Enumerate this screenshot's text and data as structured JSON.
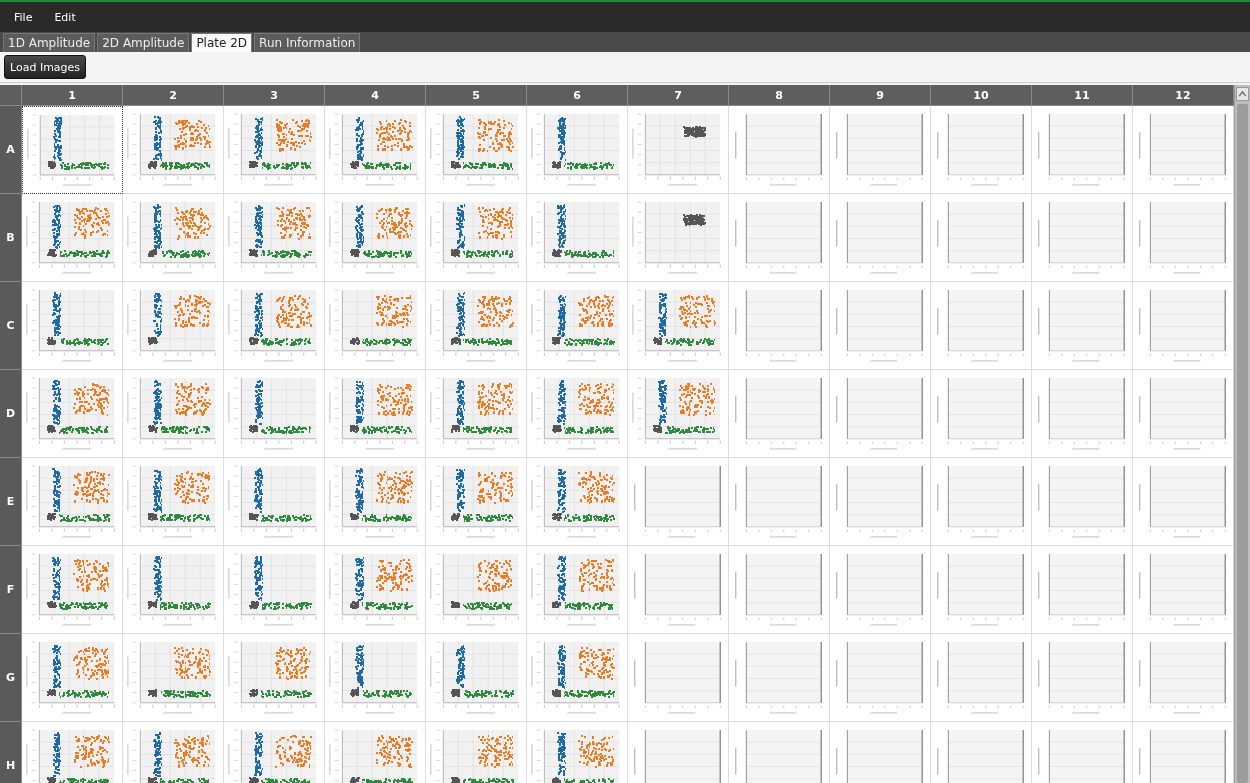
{
  "menu": [
    "File",
    "Edit"
  ],
  "tabs": [
    {
      "label": "1D Amplitude",
      "selected": false
    },
    {
      "label": "2D Amplitude",
      "selected": false
    },
    {
      "label": "Plate 2D",
      "selected": true
    },
    {
      "label": "Run Information",
      "selected": false
    }
  ],
  "toolbar": {
    "button": "Load Images"
  },
  "plate": {
    "columns": [
      "1",
      "2",
      "3",
      "4",
      "5",
      "6",
      "7",
      "8",
      "9",
      "10",
      "11",
      "12"
    ],
    "rows": [
      {
        "label": "A",
        "wells": [
          {
            "kind": "scatter",
            "selected": true,
            "clusters": [
              {
                "kind": "negative",
                "color": "#555555"
              },
              {
                "kind": "ch1",
                "color": "#1f6aa5"
              },
              {
                "kind": "ch2",
                "color": "#2e8b3e"
              }
            ]
          },
          {
            "kind": "scatter",
            "selected": false,
            "clusters": [
              {
                "kind": "negative",
                "color": "#555555"
              },
              {
                "kind": "ch1",
                "color": "#1f6aa5"
              },
              {
                "kind": "ch2",
                "color": "#2e8b3e"
              },
              {
                "kind": "double",
                "color": "#f07a1f"
              }
            ]
          },
          {
            "kind": "scatter",
            "selected": false,
            "clusters": [
              {
                "kind": "negative",
                "color": "#555555"
              },
              {
                "kind": "ch1",
                "color": "#1f6aa5"
              },
              {
                "kind": "ch2",
                "color": "#2e8b3e"
              },
              {
                "kind": "double",
                "color": "#f07a1f"
              }
            ]
          },
          {
            "kind": "scatter",
            "selected": false,
            "clusters": [
              {
                "kind": "negative",
                "color": "#555555"
              },
              {
                "kind": "ch1",
                "color": "#1f6aa5"
              },
              {
                "kind": "ch2",
                "color": "#2e8b3e"
              },
              {
                "kind": "double",
                "color": "#f07a1f"
              }
            ]
          },
          {
            "kind": "scatter",
            "selected": false,
            "clusters": [
              {
                "kind": "negative",
                "color": "#555555"
              },
              {
                "kind": "ch1",
                "color": "#1f6aa5"
              },
              {
                "kind": "ch2",
                "color": "#2e8b3e"
              },
              {
                "kind": "double",
                "color": "#f07a1f"
              }
            ]
          },
          {
            "kind": "scatter",
            "selected": false,
            "clusters": [
              {
                "kind": "negative",
                "color": "#555555"
              },
              {
                "kind": "ch1",
                "color": "#1f6aa5"
              },
              {
                "kind": "ch2",
                "color": "#2e8b3e"
              }
            ]
          },
          {
            "kind": "scatter",
            "selected": false,
            "clusters": [
              {
                "kind": "blob",
                "color": "#555555"
              }
            ]
          },
          {
            "kind": "blank",
            "selected": false
          },
          {
            "kind": "blank",
            "selected": false
          },
          {
            "kind": "blank",
            "selected": false
          },
          {
            "kind": "blank",
            "selected": false
          },
          {
            "kind": "blank",
            "selected": false
          }
        ]
      },
      {
        "label": "B",
        "wells": [
          {
            "kind": "scatter",
            "selected": false,
            "clusters": [
              {
                "kind": "negative",
                "color": "#555555"
              },
              {
                "kind": "ch1",
                "color": "#1f6aa5"
              },
              {
                "kind": "ch2",
                "color": "#2e8b3e"
              },
              {
                "kind": "double",
                "color": "#f07a1f"
              }
            ]
          },
          {
            "kind": "scatter",
            "selected": false,
            "clusters": [
              {
                "kind": "negative",
                "color": "#555555"
              },
              {
                "kind": "ch1",
                "color": "#1f6aa5"
              },
              {
                "kind": "ch2",
                "color": "#2e8b3e"
              },
              {
                "kind": "double",
                "color": "#f07a1f"
              }
            ]
          },
          {
            "kind": "scatter",
            "selected": false,
            "clusters": [
              {
                "kind": "negative",
                "color": "#555555"
              },
              {
                "kind": "ch1",
                "color": "#1f6aa5"
              },
              {
                "kind": "ch2",
                "color": "#2e8b3e"
              },
              {
                "kind": "double",
                "color": "#f07a1f"
              }
            ]
          },
          {
            "kind": "scatter",
            "selected": false,
            "clusters": [
              {
                "kind": "negative",
                "color": "#555555"
              },
              {
                "kind": "ch1",
                "color": "#1f6aa5"
              },
              {
                "kind": "ch2",
                "color": "#2e8b3e"
              },
              {
                "kind": "double",
                "color": "#f07a1f"
              }
            ]
          },
          {
            "kind": "scatter",
            "selected": false,
            "clusters": [
              {
                "kind": "negative",
                "color": "#555555"
              },
              {
                "kind": "ch1",
                "color": "#1f6aa5"
              },
              {
                "kind": "ch2",
                "color": "#2e8b3e"
              },
              {
                "kind": "double",
                "color": "#f07a1f"
              }
            ]
          },
          {
            "kind": "scatter",
            "selected": false,
            "clusters": [
              {
                "kind": "negative",
                "color": "#555555"
              },
              {
                "kind": "ch1",
                "color": "#1f6aa5"
              },
              {
                "kind": "ch2",
                "color": "#2e8b3e"
              }
            ]
          },
          {
            "kind": "scatter",
            "selected": false,
            "clusters": [
              {
                "kind": "blob",
                "color": "#555555"
              }
            ]
          },
          {
            "kind": "blank",
            "selected": false
          },
          {
            "kind": "blank",
            "selected": false
          },
          {
            "kind": "blank",
            "selected": false
          },
          {
            "kind": "blank",
            "selected": false
          },
          {
            "kind": "blank",
            "selected": false
          }
        ]
      },
      {
        "label": "C",
        "wells": [
          {
            "kind": "scatter",
            "selected": false,
            "clusters": [
              {
                "kind": "negative",
                "color": "#555555"
              },
              {
                "kind": "ch1",
                "color": "#1f6aa5"
              },
              {
                "kind": "ch2",
                "color": "#2e8b3e"
              }
            ]
          },
          {
            "kind": "scatter",
            "selected": false,
            "clusters": [
              {
                "kind": "negative",
                "color": "#555555"
              },
              {
                "kind": "ch1",
                "color": "#1f6aa5"
              },
              {
                "kind": "double",
                "color": "#f07a1f"
              }
            ]
          },
          {
            "kind": "scatter",
            "selected": false,
            "clusters": [
              {
                "kind": "negative",
                "color": "#555555"
              },
              {
                "kind": "ch1",
                "color": "#1f6aa5"
              },
              {
                "kind": "ch2",
                "color": "#2e8b3e"
              },
              {
                "kind": "double",
                "color": "#f07a1f"
              }
            ]
          },
          {
            "kind": "scatter",
            "selected": false,
            "clusters": [
              {
                "kind": "negative",
                "color": "#555555"
              },
              {
                "kind": "ch2",
                "color": "#2e8b3e"
              },
              {
                "kind": "double",
                "color": "#f07a1f"
              }
            ]
          },
          {
            "kind": "scatter",
            "selected": false,
            "clusters": [
              {
                "kind": "negative",
                "color": "#555555"
              },
              {
                "kind": "ch1",
                "color": "#1f6aa5"
              },
              {
                "kind": "ch2",
                "color": "#2e8b3e"
              },
              {
                "kind": "double",
                "color": "#f07a1f"
              }
            ]
          },
          {
            "kind": "scatter",
            "selected": false,
            "clusters": [
              {
                "kind": "negative",
                "color": "#555555"
              },
              {
                "kind": "ch1",
                "color": "#1f6aa5"
              },
              {
                "kind": "ch2",
                "color": "#2e8b3e"
              },
              {
                "kind": "double",
                "color": "#f07a1f"
              }
            ]
          },
          {
            "kind": "scatter",
            "selected": false,
            "clusters": [
              {
                "kind": "negative",
                "color": "#555555"
              },
              {
                "kind": "ch1",
                "color": "#1f6aa5"
              },
              {
                "kind": "ch2",
                "color": "#2e8b3e"
              },
              {
                "kind": "double",
                "color": "#f07a1f"
              }
            ]
          },
          {
            "kind": "blank",
            "selected": false
          },
          {
            "kind": "blank",
            "selected": false
          },
          {
            "kind": "blank",
            "selected": false
          },
          {
            "kind": "blank",
            "selected": false
          },
          {
            "kind": "blank",
            "selected": false
          }
        ]
      },
      {
        "label": "D",
        "wells": [
          {
            "kind": "scatter",
            "selected": false,
            "clusters": [
              {
                "kind": "negative",
                "color": "#555555"
              },
              {
                "kind": "ch1",
                "color": "#1f6aa5"
              },
              {
                "kind": "ch2",
                "color": "#2e8b3e"
              },
              {
                "kind": "double",
                "color": "#f07a1f"
              }
            ]
          },
          {
            "kind": "scatter",
            "selected": false,
            "clusters": [
              {
                "kind": "negative",
                "color": "#555555"
              },
              {
                "kind": "ch1",
                "color": "#1f6aa5"
              },
              {
                "kind": "ch2",
                "color": "#2e8b3e"
              },
              {
                "kind": "double",
                "color": "#f07a1f"
              }
            ]
          },
          {
            "kind": "scatter",
            "selected": false,
            "clusters": [
              {
                "kind": "negative",
                "color": "#555555"
              },
              {
                "kind": "ch1",
                "color": "#1f6aa5"
              },
              {
                "kind": "ch2",
                "color": "#2e8b3e"
              }
            ]
          },
          {
            "kind": "scatter",
            "selected": false,
            "clusters": [
              {
                "kind": "negative",
                "color": "#555555"
              },
              {
                "kind": "ch1",
                "color": "#1f6aa5"
              },
              {
                "kind": "ch2",
                "color": "#2e8b3e"
              },
              {
                "kind": "double",
                "color": "#f07a1f"
              }
            ]
          },
          {
            "kind": "scatter",
            "selected": false,
            "clusters": [
              {
                "kind": "negative",
                "color": "#555555"
              },
              {
                "kind": "ch1",
                "color": "#1f6aa5"
              },
              {
                "kind": "ch2",
                "color": "#2e8b3e"
              },
              {
                "kind": "double",
                "color": "#f07a1f"
              }
            ]
          },
          {
            "kind": "scatter",
            "selected": false,
            "clusters": [
              {
                "kind": "negative",
                "color": "#555555"
              },
              {
                "kind": "ch1",
                "color": "#1f6aa5"
              },
              {
                "kind": "ch2",
                "color": "#2e8b3e"
              },
              {
                "kind": "double",
                "color": "#f07a1f"
              }
            ]
          },
          {
            "kind": "scatter",
            "selected": false,
            "clusters": [
              {
                "kind": "negative",
                "color": "#555555"
              },
              {
                "kind": "ch1",
                "color": "#1f6aa5"
              },
              {
                "kind": "ch2",
                "color": "#2e8b3e"
              },
              {
                "kind": "double",
                "color": "#f07a1f"
              }
            ]
          },
          {
            "kind": "blank",
            "selected": false
          },
          {
            "kind": "blank",
            "selected": false
          },
          {
            "kind": "blank",
            "selected": false
          },
          {
            "kind": "blank",
            "selected": false
          },
          {
            "kind": "blank",
            "selected": false
          }
        ]
      },
      {
        "label": "E",
        "wells": [
          {
            "kind": "scatter",
            "selected": false,
            "clusters": [
              {
                "kind": "negative",
                "color": "#555555"
              },
              {
                "kind": "ch1",
                "color": "#1f6aa5"
              },
              {
                "kind": "ch2",
                "color": "#2e8b3e"
              },
              {
                "kind": "double",
                "color": "#f07a1f"
              }
            ]
          },
          {
            "kind": "scatter",
            "selected": false,
            "clusters": [
              {
                "kind": "negative",
                "color": "#555555"
              },
              {
                "kind": "ch1",
                "color": "#1f6aa5"
              },
              {
                "kind": "ch2",
                "color": "#2e8b3e"
              },
              {
                "kind": "double",
                "color": "#f07a1f"
              }
            ]
          },
          {
            "kind": "scatter",
            "selected": false,
            "clusters": [
              {
                "kind": "negative",
                "color": "#555555"
              },
              {
                "kind": "ch1",
                "color": "#1f6aa5"
              },
              {
                "kind": "ch2",
                "color": "#2e8b3e"
              }
            ]
          },
          {
            "kind": "scatter",
            "selected": false,
            "clusters": [
              {
                "kind": "negative",
                "color": "#555555"
              },
              {
                "kind": "ch1",
                "color": "#1f6aa5"
              },
              {
                "kind": "ch2",
                "color": "#2e8b3e"
              },
              {
                "kind": "double",
                "color": "#f07a1f"
              }
            ]
          },
          {
            "kind": "scatter",
            "selected": false,
            "clusters": [
              {
                "kind": "negative",
                "color": "#555555"
              },
              {
                "kind": "ch1",
                "color": "#1f6aa5"
              },
              {
                "kind": "ch2",
                "color": "#2e8b3e"
              },
              {
                "kind": "double",
                "color": "#f07a1f"
              }
            ]
          },
          {
            "kind": "scatter",
            "selected": false,
            "clusters": [
              {
                "kind": "negative",
                "color": "#555555"
              },
              {
                "kind": "ch1",
                "color": "#1f6aa5"
              },
              {
                "kind": "ch2",
                "color": "#2e8b3e"
              },
              {
                "kind": "double",
                "color": "#f07a1f"
              }
            ]
          },
          {
            "kind": "blank",
            "selected": false
          },
          {
            "kind": "blank",
            "selected": false
          },
          {
            "kind": "blank",
            "selected": false
          },
          {
            "kind": "blank",
            "selected": false
          },
          {
            "kind": "blank",
            "selected": false
          },
          {
            "kind": "blank",
            "selected": false
          }
        ]
      },
      {
        "label": "F",
        "wells": [
          {
            "kind": "scatter",
            "selected": false,
            "clusters": [
              {
                "kind": "negative",
                "color": "#555555"
              },
              {
                "kind": "ch1",
                "color": "#1f6aa5"
              },
              {
                "kind": "ch2",
                "color": "#2e8b3e"
              },
              {
                "kind": "double",
                "color": "#f07a1f"
              }
            ]
          },
          {
            "kind": "scatter",
            "selected": false,
            "clusters": [
              {
                "kind": "negative",
                "color": "#555555"
              },
              {
                "kind": "ch1",
                "color": "#1f6aa5"
              },
              {
                "kind": "ch2",
                "color": "#2e8b3e"
              }
            ]
          },
          {
            "kind": "scatter",
            "selected": false,
            "clusters": [
              {
                "kind": "negative",
                "color": "#555555"
              },
              {
                "kind": "ch1",
                "color": "#1f6aa5"
              },
              {
                "kind": "ch2",
                "color": "#2e8b3e"
              }
            ]
          },
          {
            "kind": "scatter",
            "selected": false,
            "clusters": [
              {
                "kind": "negative",
                "color": "#555555"
              },
              {
                "kind": "ch1",
                "color": "#1f6aa5"
              },
              {
                "kind": "ch2",
                "color": "#2e8b3e"
              },
              {
                "kind": "double",
                "color": "#f07a1f"
              }
            ]
          },
          {
            "kind": "scatter",
            "selected": false,
            "clusters": [
              {
                "kind": "negative",
                "color": "#555555"
              },
              {
                "kind": "ch2",
                "color": "#2e8b3e"
              },
              {
                "kind": "double",
                "color": "#f07a1f"
              }
            ]
          },
          {
            "kind": "scatter",
            "selected": false,
            "clusters": [
              {
                "kind": "negative",
                "color": "#555555"
              },
              {
                "kind": "ch1",
                "color": "#1f6aa5"
              },
              {
                "kind": "ch2",
                "color": "#2e8b3e"
              },
              {
                "kind": "double",
                "color": "#f07a1f"
              }
            ]
          },
          {
            "kind": "blank",
            "selected": false
          },
          {
            "kind": "blank",
            "selected": false
          },
          {
            "kind": "blank",
            "selected": false
          },
          {
            "kind": "blank",
            "selected": false
          },
          {
            "kind": "blank",
            "selected": false
          },
          {
            "kind": "blank",
            "selected": false
          }
        ]
      },
      {
        "label": "G",
        "wells": [
          {
            "kind": "scatter",
            "selected": false,
            "clusters": [
              {
                "kind": "negative",
                "color": "#555555"
              },
              {
                "kind": "ch1",
                "color": "#1f6aa5"
              },
              {
                "kind": "ch2",
                "color": "#2e8b3e"
              },
              {
                "kind": "double",
                "color": "#f07a1f"
              }
            ]
          },
          {
            "kind": "scatter",
            "selected": false,
            "clusters": [
              {
                "kind": "negative",
                "color": "#555555"
              },
              {
                "kind": "ch2",
                "color": "#2e8b3e"
              },
              {
                "kind": "double",
                "color": "#f07a1f"
              }
            ]
          },
          {
            "kind": "scatter",
            "selected": false,
            "clusters": [
              {
                "kind": "negative",
                "color": "#555555"
              },
              {
                "kind": "ch2",
                "color": "#2e8b3e"
              },
              {
                "kind": "double",
                "color": "#f07a1f"
              }
            ]
          },
          {
            "kind": "scatter",
            "selected": false,
            "clusters": [
              {
                "kind": "negative",
                "color": "#555555"
              },
              {
                "kind": "ch1",
                "color": "#1f6aa5"
              },
              {
                "kind": "ch2",
                "color": "#2e8b3e"
              }
            ]
          },
          {
            "kind": "scatter",
            "selected": false,
            "clusters": [
              {
                "kind": "negative",
                "color": "#555555"
              },
              {
                "kind": "ch1",
                "color": "#1f6aa5"
              },
              {
                "kind": "ch2",
                "color": "#2e8b3e"
              }
            ]
          },
          {
            "kind": "scatter",
            "selected": false,
            "clusters": [
              {
                "kind": "negative",
                "color": "#555555"
              },
              {
                "kind": "ch1",
                "color": "#1f6aa5"
              },
              {
                "kind": "ch2",
                "color": "#2e8b3e"
              },
              {
                "kind": "double",
                "color": "#f07a1f"
              }
            ]
          },
          {
            "kind": "blank",
            "selected": false
          },
          {
            "kind": "blank",
            "selected": false
          },
          {
            "kind": "blank",
            "selected": false
          },
          {
            "kind": "blank",
            "selected": false
          },
          {
            "kind": "blank",
            "selected": false
          },
          {
            "kind": "blank",
            "selected": false
          }
        ]
      },
      {
        "label": "H",
        "wells": [
          {
            "kind": "scatter",
            "selected": false,
            "clusters": [
              {
                "kind": "negative",
                "color": "#555555"
              },
              {
                "kind": "ch1",
                "color": "#1f6aa5"
              },
              {
                "kind": "ch2",
                "color": "#2e8b3e"
              },
              {
                "kind": "double",
                "color": "#f07a1f"
              }
            ]
          },
          {
            "kind": "scatter",
            "selected": false,
            "clusters": [
              {
                "kind": "negative",
                "color": "#555555"
              },
              {
                "kind": "ch1",
                "color": "#1f6aa5"
              },
              {
                "kind": "ch2",
                "color": "#2e8b3e"
              },
              {
                "kind": "double",
                "color": "#f07a1f"
              }
            ]
          },
          {
            "kind": "scatter",
            "selected": false,
            "clusters": [
              {
                "kind": "negative",
                "color": "#555555"
              },
              {
                "kind": "ch1",
                "color": "#1f6aa5"
              },
              {
                "kind": "ch2",
                "color": "#2e8b3e"
              },
              {
                "kind": "double",
                "color": "#f07a1f"
              }
            ]
          },
          {
            "kind": "scatter",
            "selected": false,
            "clusters": [
              {
                "kind": "negative",
                "color": "#555555"
              },
              {
                "kind": "ch2",
                "color": "#2e8b3e"
              },
              {
                "kind": "double",
                "color": "#f07a1f"
              }
            ]
          },
          {
            "kind": "scatter",
            "selected": false,
            "clusters": [
              {
                "kind": "negative",
                "color": "#555555"
              },
              {
                "kind": "ch2",
                "color": "#2e8b3e"
              },
              {
                "kind": "double",
                "color": "#f07a1f"
              }
            ]
          },
          {
            "kind": "scatter",
            "selected": false,
            "clusters": [
              {
                "kind": "negative",
                "color": "#555555"
              },
              {
                "kind": "ch1",
                "color": "#1f6aa5"
              },
              {
                "kind": "ch2",
                "color": "#2e8b3e"
              },
              {
                "kind": "double",
                "color": "#f07a1f"
              }
            ]
          },
          {
            "kind": "blank",
            "selected": false
          },
          {
            "kind": "blank",
            "selected": false
          },
          {
            "kind": "blank",
            "selected": false
          },
          {
            "kind": "blank",
            "selected": false
          },
          {
            "kind": "blank",
            "selected": false
          },
          {
            "kind": "blank",
            "selected": false
          }
        ]
      }
    ]
  }
}
